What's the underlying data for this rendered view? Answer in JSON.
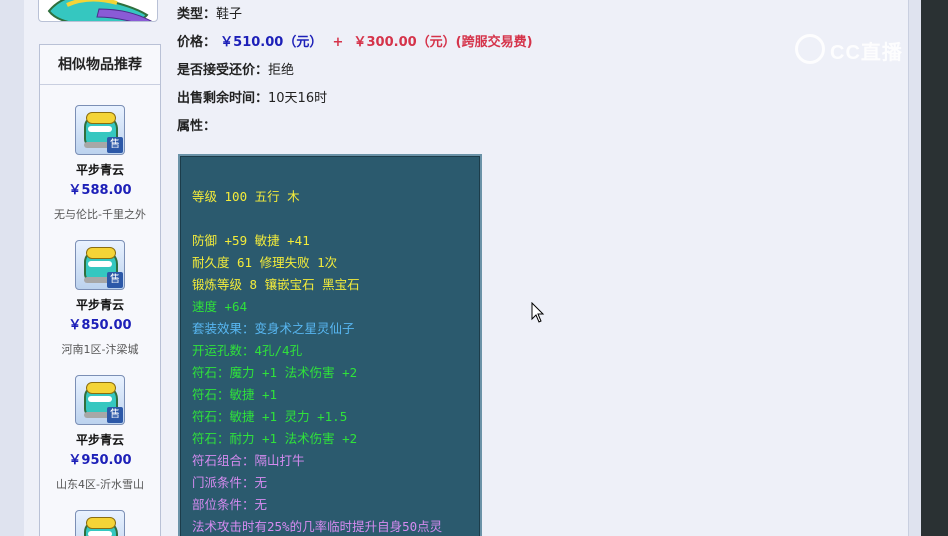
{
  "item": {
    "type_label": "类型：",
    "type_value": "鞋子",
    "price_label": "价格：",
    "price_value": "￥510.00（元）",
    "price_plus": "+",
    "price_fee": "￥300.00（元）(跨服交易费)",
    "bargain_label": "是否接受还价：",
    "bargain_value": "拒绝",
    "remaining_label": "出售剩余时间：",
    "remaining_value": "10天16时",
    "attributes_label": "属性："
  },
  "attributes": [
    {
      "text": "等级 100 五行 木",
      "color": "yellow"
    },
    {
      "text": "防御 +59 敏捷 +41",
      "color": "yellow"
    },
    {
      "text": "耐久度 61 修理失败 1次",
      "color": "yellow"
    },
    {
      "text": "锻炼等级 8 镶嵌宝石 黑宝石",
      "color": "yellow"
    },
    {
      "text": "速度 +64",
      "color": "green"
    },
    {
      "text": "套装效果：变身术之星灵仙子",
      "color": "blue"
    },
    {
      "text": "开运孔数：4孔/4孔",
      "color": "green"
    },
    {
      "text": "符石：魔力 +1 法术伤害 +2",
      "color": "green"
    },
    {
      "text": "符石：敏捷 +1",
      "color": "green"
    },
    {
      "text": "符石：敏捷 +1 灵力 +1.5",
      "color": "green"
    },
    {
      "text": "符石：耐力 +1 法术伤害 +2",
      "color": "green"
    },
    {
      "text": "符石组合：隔山打牛",
      "color": "purple"
    },
    {
      "text": "门派条件：无",
      "color": "purple"
    },
    {
      "text": "部位条件：无",
      "color": "purple"
    },
    {
      "text": "法术攻击时有25%的几率临时提升自身50点灵",
      "color": "purple"
    }
  ],
  "sidebar": {
    "title": "相似物品推荐",
    "items": [
      {
        "name": "平步青云",
        "price": "￥588.00",
        "server": "无与伦比-千里之外",
        "tag": "售"
      },
      {
        "name": "平步青云",
        "price": "￥850.00",
        "server": "河南1区-汴梁城",
        "tag": "售"
      },
      {
        "name": "平步青云",
        "price": "￥950.00",
        "server": "山东4区-沂水雪山",
        "tag": "售"
      }
    ]
  },
  "watermark": {
    "text": "CC直播"
  },
  "colors": {
    "page_bg": "#eef0f8",
    "price_blue": "#1d20b8",
    "fee_red": "#d5334a",
    "attr_bg": "#2b5a6e",
    "attr_yellow": "#f4ec3a",
    "attr_green": "#2fe23a",
    "attr_blue": "#58b7f2",
    "attr_purple": "#d58bf0"
  },
  "icons": {
    "item": "shoe-icon",
    "cursor": "mouse-cursor-icon",
    "watermark": "cc-logo-icon"
  }
}
